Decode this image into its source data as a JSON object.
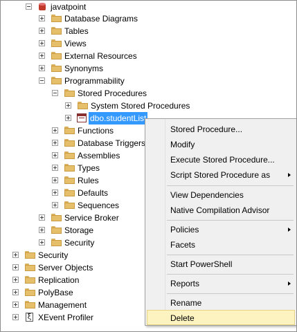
{
  "tree": {
    "database": "javatpoint",
    "db_children": [
      "Database Diagrams",
      "Tables",
      "Views",
      "External Resources",
      "Synonyms",
      "Programmability"
    ],
    "programmability_children": [
      "Stored Procedures"
    ],
    "sp_children": [
      "System Stored Procedures"
    ],
    "selected_node": "dbo.studentList",
    "after_sp": [
      "Functions",
      "Database Triggers",
      "Assemblies",
      "Types",
      "Rules",
      "Defaults",
      "Sequences"
    ],
    "more_db": [
      "Service Broker",
      "Storage",
      "Security"
    ],
    "top_level": [
      "Security",
      "Server Objects",
      "Replication",
      "PolyBase",
      "Management",
      "XEvent Profiler"
    ]
  },
  "context_menu": {
    "items": [
      {
        "label": "Stored Procedure...",
        "submenu": false
      },
      {
        "label": "Modify",
        "submenu": false
      },
      {
        "label": "Execute Stored Procedure...",
        "submenu": false
      },
      {
        "label": "Script Stored Procedure as",
        "submenu": true
      },
      {
        "label": "View Dependencies",
        "submenu": false
      },
      {
        "label": "Native Compilation Advisor",
        "submenu": false
      },
      {
        "label": "Policies",
        "submenu": true
      },
      {
        "label": "Facets",
        "submenu": false
      },
      {
        "label": "Start PowerShell",
        "submenu": false
      },
      {
        "label": "Reports",
        "submenu": true
      },
      {
        "label": "Rename",
        "submenu": false
      },
      {
        "label": "Delete",
        "submenu": false,
        "highlighted": true
      }
    ]
  },
  "colors": {
    "selection": "#3399ff",
    "folder": "#e6bf6a",
    "menu_bg": "#f0f0f0",
    "highlight": "#fdf3c0"
  }
}
